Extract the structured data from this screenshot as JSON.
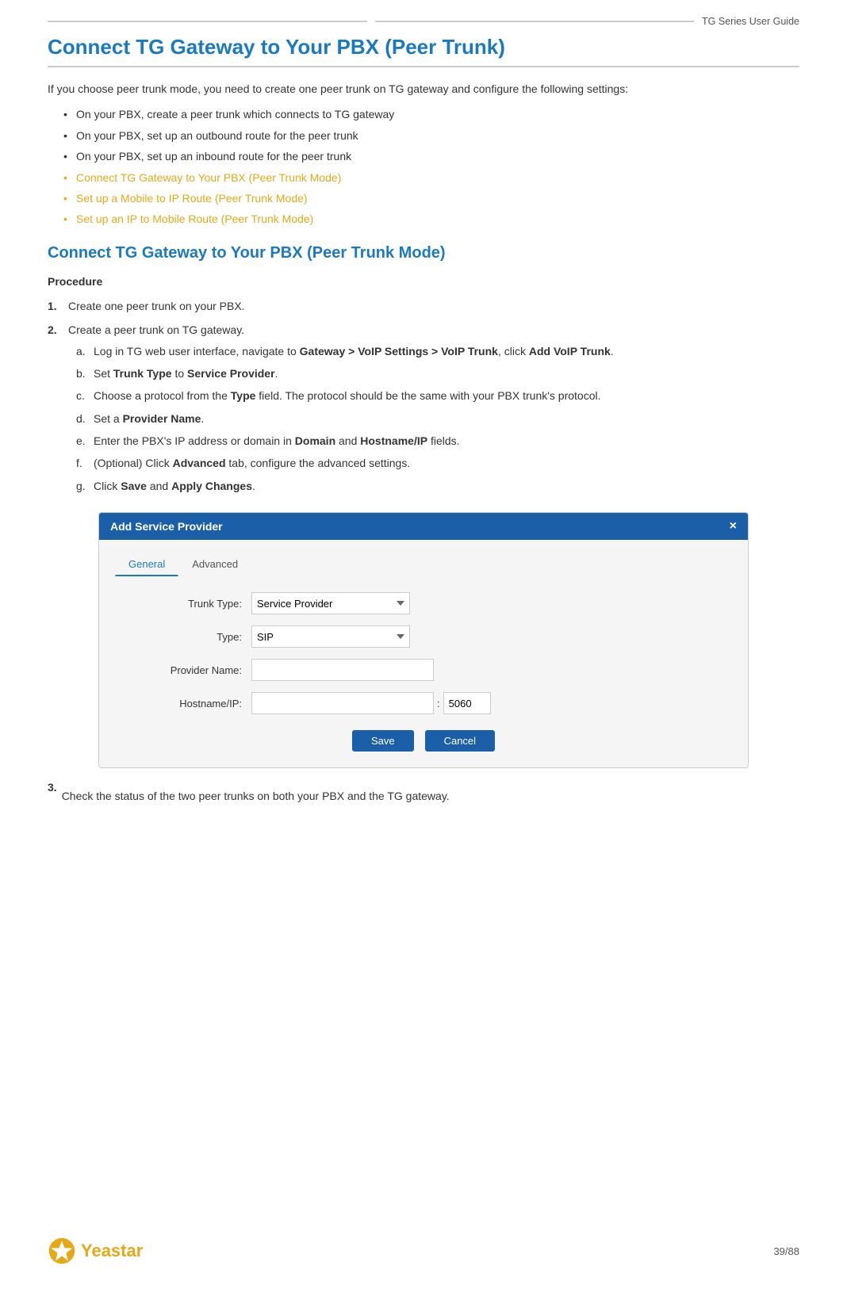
{
  "header": {
    "line1": "",
    "line2": "",
    "guide_title": "TG  Series  User  Guide"
  },
  "main_title": "Connect TG Gateway to Your PBX (Peer Trunk)",
  "intro": {
    "paragraph": "If you choose peer trunk mode, you need to create one peer trunk on TG gateway and configure the following settings:"
  },
  "bullets": {
    "plain": [
      "On your PBX, create a peer trunk which connects to TG gateway",
      "On your PBX, set up an outbound route for the peer trunk",
      "On your PBX, set up an inbound route for the peer trunk"
    ],
    "links": [
      "Connect TG Gateway to Your PBX (Peer Trunk Mode)",
      "Set up a Mobile to IP Route (Peer Trunk Mode)",
      "Set up an IP to Mobile Route (Peer Trunk Mode)"
    ]
  },
  "section2_title": "Connect TG Gateway to Your PBX (Peer Trunk Mode)",
  "procedure_label": "Procedure",
  "steps": [
    {
      "num": "1.",
      "text": "Create one peer trunk on your PBX."
    },
    {
      "num": "2.",
      "text": "Create a peer trunk on TG gateway."
    }
  ],
  "substeps": [
    {
      "letter": "a.",
      "text_before": "Log in TG web user interface, navigate to ",
      "bold1": "Gateway > VoIP Settings > VoIP Trunk",
      "text_mid": ", click ",
      "bold2": "Add VoIP Trunk",
      "text_after": "."
    },
    {
      "letter": "b.",
      "text_before": "Set ",
      "bold1": "Trunk Type",
      "text_mid": " to ",
      "bold2": "Service Provider",
      "text_after": "."
    },
    {
      "letter": "c.",
      "text_before": "Choose a protocol from the ",
      "bold1": "Type",
      "text_mid": " field. The protocol should be the same with your PBX trunk's protocol.",
      "bold2": "",
      "text_after": ""
    },
    {
      "letter": "d.",
      "text_before": "Set a ",
      "bold1": "Provider Name",
      "text_mid": ".",
      "bold2": "",
      "text_after": ""
    },
    {
      "letter": "e.",
      "text_before": "Enter the PBX's IP address or domain in ",
      "bold1": "Domain",
      "text_mid": " and ",
      "bold2": "Hostname/IP",
      "text_after": " fields."
    },
    {
      "letter": "f.",
      "text_before": "(Optional) Click ",
      "bold1": "Advanced",
      "text_mid": " tab, configure the advanced settings.",
      "bold2": "",
      "text_after": ""
    },
    {
      "letter": "g.",
      "text_before": "Click ",
      "bold1": "Save",
      "text_mid": " and ",
      "bold2": "Apply Changes",
      "text_after": "."
    }
  ],
  "dialog": {
    "title": "Add Service Provider",
    "close_icon": "×",
    "tabs": [
      {
        "label": "General",
        "active": true
      },
      {
        "label": "Advanced",
        "active": false
      }
    ],
    "form_fields": [
      {
        "label": "Trunk Type:",
        "type": "select",
        "value": "Service Provider"
      },
      {
        "label": "Type:",
        "type": "select",
        "value": "SIP"
      },
      {
        "label": "Provider Name:",
        "type": "text",
        "value": ""
      },
      {
        "label": "Hostname/IP:",
        "type": "hostname",
        "value": "",
        "port": "5060"
      }
    ],
    "buttons": {
      "save": "Save",
      "cancel": "Cancel"
    }
  },
  "step3": {
    "num": "3.",
    "text": "Check the status of the two peer trunks on both your PBX and the TG gateway."
  },
  "footer": {
    "logo_text": "Yeastar",
    "page_info": "39/88"
  }
}
